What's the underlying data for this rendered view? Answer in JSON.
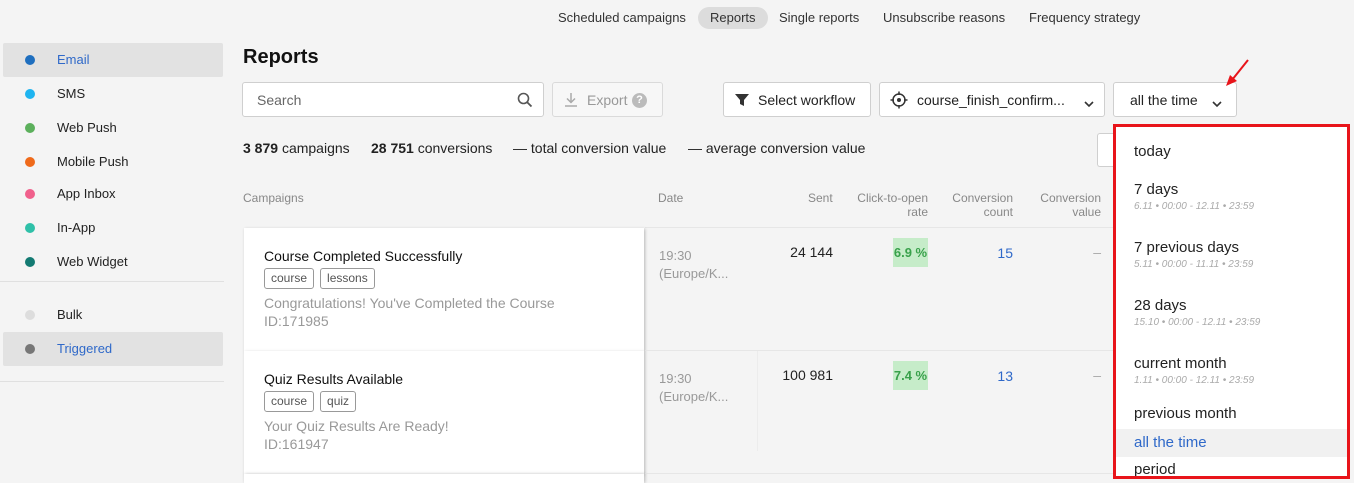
{
  "top_nav": {
    "tabs": [
      {
        "label": "Scheduled campaigns",
        "active": false
      },
      {
        "label": "Reports",
        "active": true
      },
      {
        "label": "Single reports",
        "active": false
      },
      {
        "label": "Unsubscribe reasons",
        "active": false
      },
      {
        "label": "Frequency strategy",
        "active": false
      }
    ]
  },
  "sidebar": {
    "items": [
      {
        "label": "Email",
        "dot_color": "#1f6fbf",
        "active": true
      },
      {
        "label": "SMS",
        "dot_color": "#1eb4f0",
        "active": false
      },
      {
        "label": "Web Push",
        "dot_color": "#5cb05c",
        "active": false
      },
      {
        "label": "Mobile Push",
        "dot_color": "#ef6a1a",
        "active": false
      },
      {
        "label": "App Inbox",
        "dot_color": "#f0608c",
        "active": false
      },
      {
        "label": "In-App",
        "dot_color": "#2fc0a8",
        "active": false
      },
      {
        "label": "Web Widget",
        "dot_color": "#137a72",
        "active": false
      }
    ],
    "modes": [
      {
        "label": "Bulk",
        "dot_color": "#dddddd",
        "active": false
      },
      {
        "label": "Triggered",
        "dot_color": "#777777",
        "active": true
      }
    ]
  },
  "page": {
    "title": "Reports",
    "search_placeholder": "Search",
    "export_label": "Export",
    "select_workflow_label": "Select workflow",
    "campaign_filter_label": "course_finish_confirm...",
    "period_label": "all the time"
  },
  "stats": {
    "campaigns_count": "3 879",
    "campaigns_label": "campaigns",
    "conversions_count": "28 751",
    "conversions_label": "conversions",
    "total_value": "— total conversion value",
    "average_value": "— average conversion value"
  },
  "table": {
    "headers": {
      "campaigns": "Campaigns",
      "date": "Date",
      "sent": "Sent",
      "click_to_open_1": "Click-to-open",
      "click_to_open_2": "rate",
      "conv_count_1": "Conversion",
      "conv_count_2": "count",
      "conv_value_1": "Conversion",
      "conv_value_2": "value"
    },
    "rows": [
      {
        "name": "Course Completed Successfully",
        "tags": [
          "course",
          "lessons"
        ],
        "subject": "Congratulations! You've Completed the Course",
        "id": "ID:171985",
        "time": "19:30",
        "tz": "(Europe/K...",
        "sent": "24 144",
        "rate": "6.9 %",
        "conv_count": "15",
        "conv_value": "–"
      },
      {
        "name": "Quiz Results Available",
        "tags": [
          "course",
          "quiz"
        ],
        "subject": "Your Quiz Results Are Ready!",
        "id": "ID:161947",
        "time": "19:30",
        "tz": "(Europe/K...",
        "sent": "100 981",
        "rate": "7.4 %",
        "conv_count": "13",
        "conv_value": "–"
      }
    ]
  },
  "period_dropdown": {
    "options": [
      {
        "label": "today",
        "range": ""
      },
      {
        "label": "7 days",
        "range": "6.11 • 00:00 - 12.11 • 23:59"
      },
      {
        "label": "7 previous days",
        "range": "5.11 • 00:00 - 11.11 • 23:59"
      },
      {
        "label": "28 days",
        "range": "15.10 • 00:00 - 12.11 • 23:59"
      },
      {
        "label": "current month",
        "range": "1.11 • 00:00 - 12.11 • 23:59"
      },
      {
        "label": "previous month",
        "range": ""
      },
      {
        "label": "all the time",
        "range": "",
        "selected": true
      },
      {
        "label": "period",
        "range": ""
      }
    ]
  },
  "colors": {
    "accent": "#2f69c9",
    "highlight_border": "#e8141a",
    "rate_bg": "#c6ecc9",
    "rate_text": "#39a14b"
  }
}
